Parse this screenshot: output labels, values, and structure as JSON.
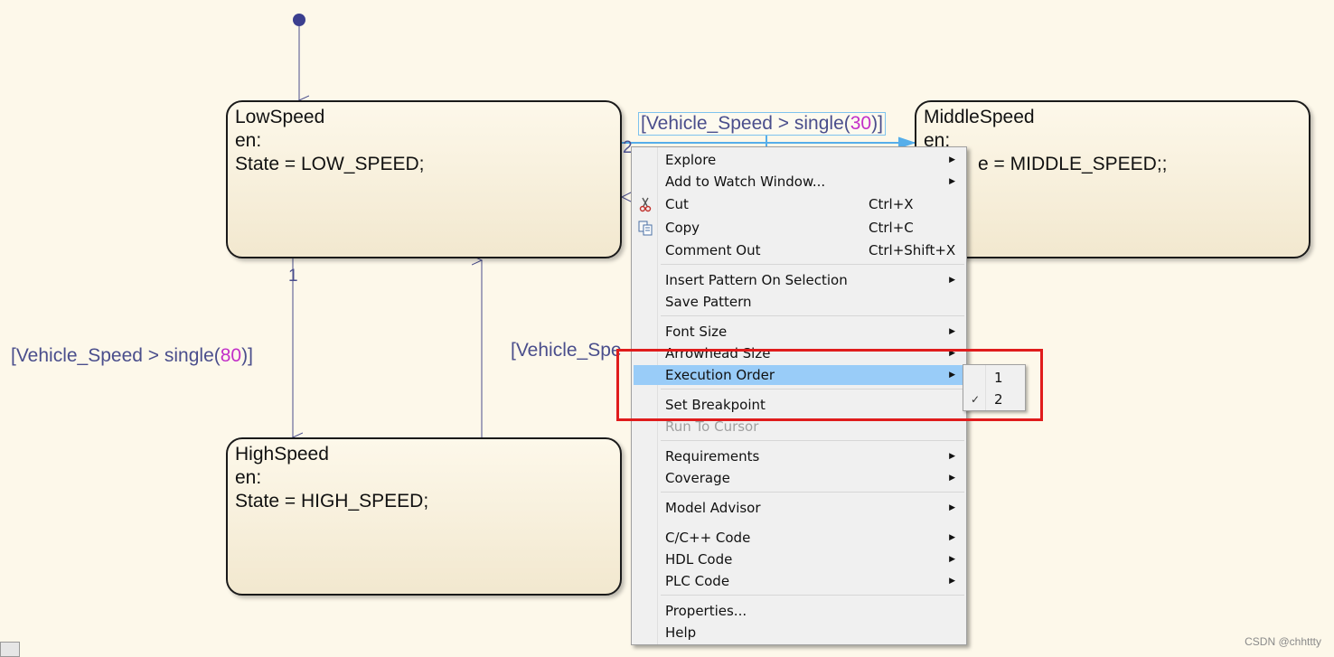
{
  "states": {
    "low": {
      "name": "LowSpeed",
      "line2": "en:",
      "line3": "State = LOW_SPEED;"
    },
    "middle": {
      "name": "MiddleSpeed",
      "line2": "en:",
      "line3": "e = MIDDLE_SPEED;;"
    },
    "high": {
      "name": "HighSpeed",
      "line2": "en:",
      "line3": "State = HIGH_SPEED;"
    }
  },
  "transitions": {
    "low_to_middle": {
      "prefix": "[Vehicle_Speed > single(",
      "num": "30",
      "suffix": ")]",
      "order": "2"
    },
    "low_to_high": {
      "prefix": "[Vehicle_Speed > single(",
      "num": "80",
      "suffix": ")]",
      "order": "1"
    },
    "high_to_low": {
      "text": "[Vehicle_Spe"
    }
  },
  "menu": {
    "items": [
      {
        "label": "Explore",
        "submenu": true
      },
      {
        "label": "Add to Watch Window...",
        "submenu": true
      },
      {
        "label": "Cut",
        "shortcut": "Ctrl+X",
        "icon": "scissors-icon"
      },
      {
        "label": "Copy",
        "shortcut": "Ctrl+C",
        "icon": "copy-icon"
      },
      {
        "label": "Comment Out",
        "shortcut": "Ctrl+Shift+X"
      },
      {
        "label": "Insert Pattern On Selection",
        "submenu": true
      },
      {
        "label": "Save Pattern"
      },
      {
        "label": "Font Size",
        "submenu": true
      },
      {
        "label": "Arrowhead Size",
        "submenu": true
      },
      {
        "label": "Execution Order",
        "submenu": true,
        "highlighted": true
      },
      {
        "label": "Set Breakpoint"
      },
      {
        "label": "Run To Cursor",
        "disabled": true
      },
      {
        "label": "Requirements",
        "submenu": true
      },
      {
        "label": "Coverage",
        "submenu": true
      },
      {
        "label": "Model Advisor",
        "submenu": true
      },
      {
        "label": "C/C++ Code",
        "submenu": true
      },
      {
        "label": "HDL Code",
        "submenu": true
      },
      {
        "label": "PLC Code",
        "submenu": true
      },
      {
        "label": "Properties..."
      },
      {
        "label": "Help"
      }
    ]
  },
  "execution_order_submenu": {
    "options": [
      "1",
      "2"
    ],
    "selected": "2"
  },
  "colors": {
    "canvas": "#fdf8ea",
    "transition": "#4a4e8c",
    "number": "#c22fc8",
    "menu_highlight": "#99ccf8",
    "annotation_box": "#e01c1c"
  },
  "watermark": "CSDN @chhttty"
}
